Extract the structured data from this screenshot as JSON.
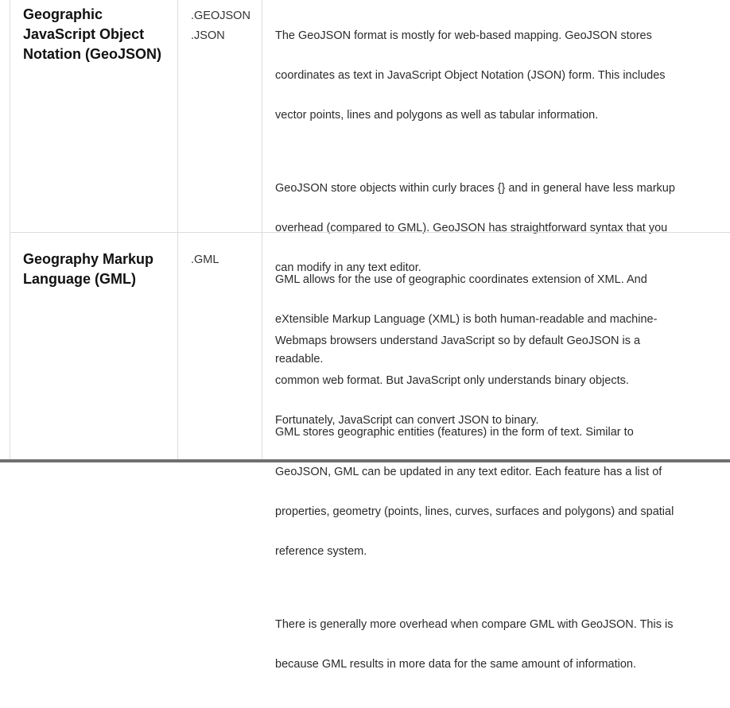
{
  "rows": [
    {
      "format_name": "Geographic\nJavaScript Object\nNotation (GeoJSON)",
      "extensions": [
        ".GEOJSON",
        ".JSON"
      ],
      "paragraphs": [
        {
          "lines": [
            "The GeoJSON format is mostly for web-based mapping. GeoJSON stores",
            "coordinates as text in JavaScript Object Notation (JSON) form. This includes",
            "vector points, lines and polygons as well as tabular information."
          ]
        },
        {
          "lines": [
            "GeoJSON store objects within curly braces {} and in general have less markup",
            "overhead (compared to GML). GeoJSON has straightforward syntax that you",
            "can modify in any text editor."
          ]
        },
        {
          "lines": [
            "Webmaps browsers understand JavaScript so by default GeoJSON is a",
            "common web format. But JavaScript only understands binary objects.",
            "Fortunately, JavaScript can convert JSON to binary."
          ]
        }
      ]
    },
    {
      "format_name": "Geography Markup\nLanguage (GML)",
      "extensions": [
        ".GML"
      ],
      "paragraphs": [
        {
          "lines": [
            "GML allows for the use of geographic coordinates extension of XML. And",
            "eXtensible Markup Language (XML) is both human-readable and machine-",
            "readable."
          ]
        },
        {
          "lines": [
            "GML stores geographic entities (features) in the form of text. Similar to",
            "GeoJSON, GML can be updated in any text editor. Each feature has a list of",
            "properties, geometry (points, lines, curves, surfaces and polygons) and spatial",
            "reference system."
          ]
        },
        {
          "lines": [
            "There is generally more overhead when compare GML with GeoJSON. This is",
            "because GML results in more data for the same amount of information."
          ]
        }
      ]
    }
  ]
}
